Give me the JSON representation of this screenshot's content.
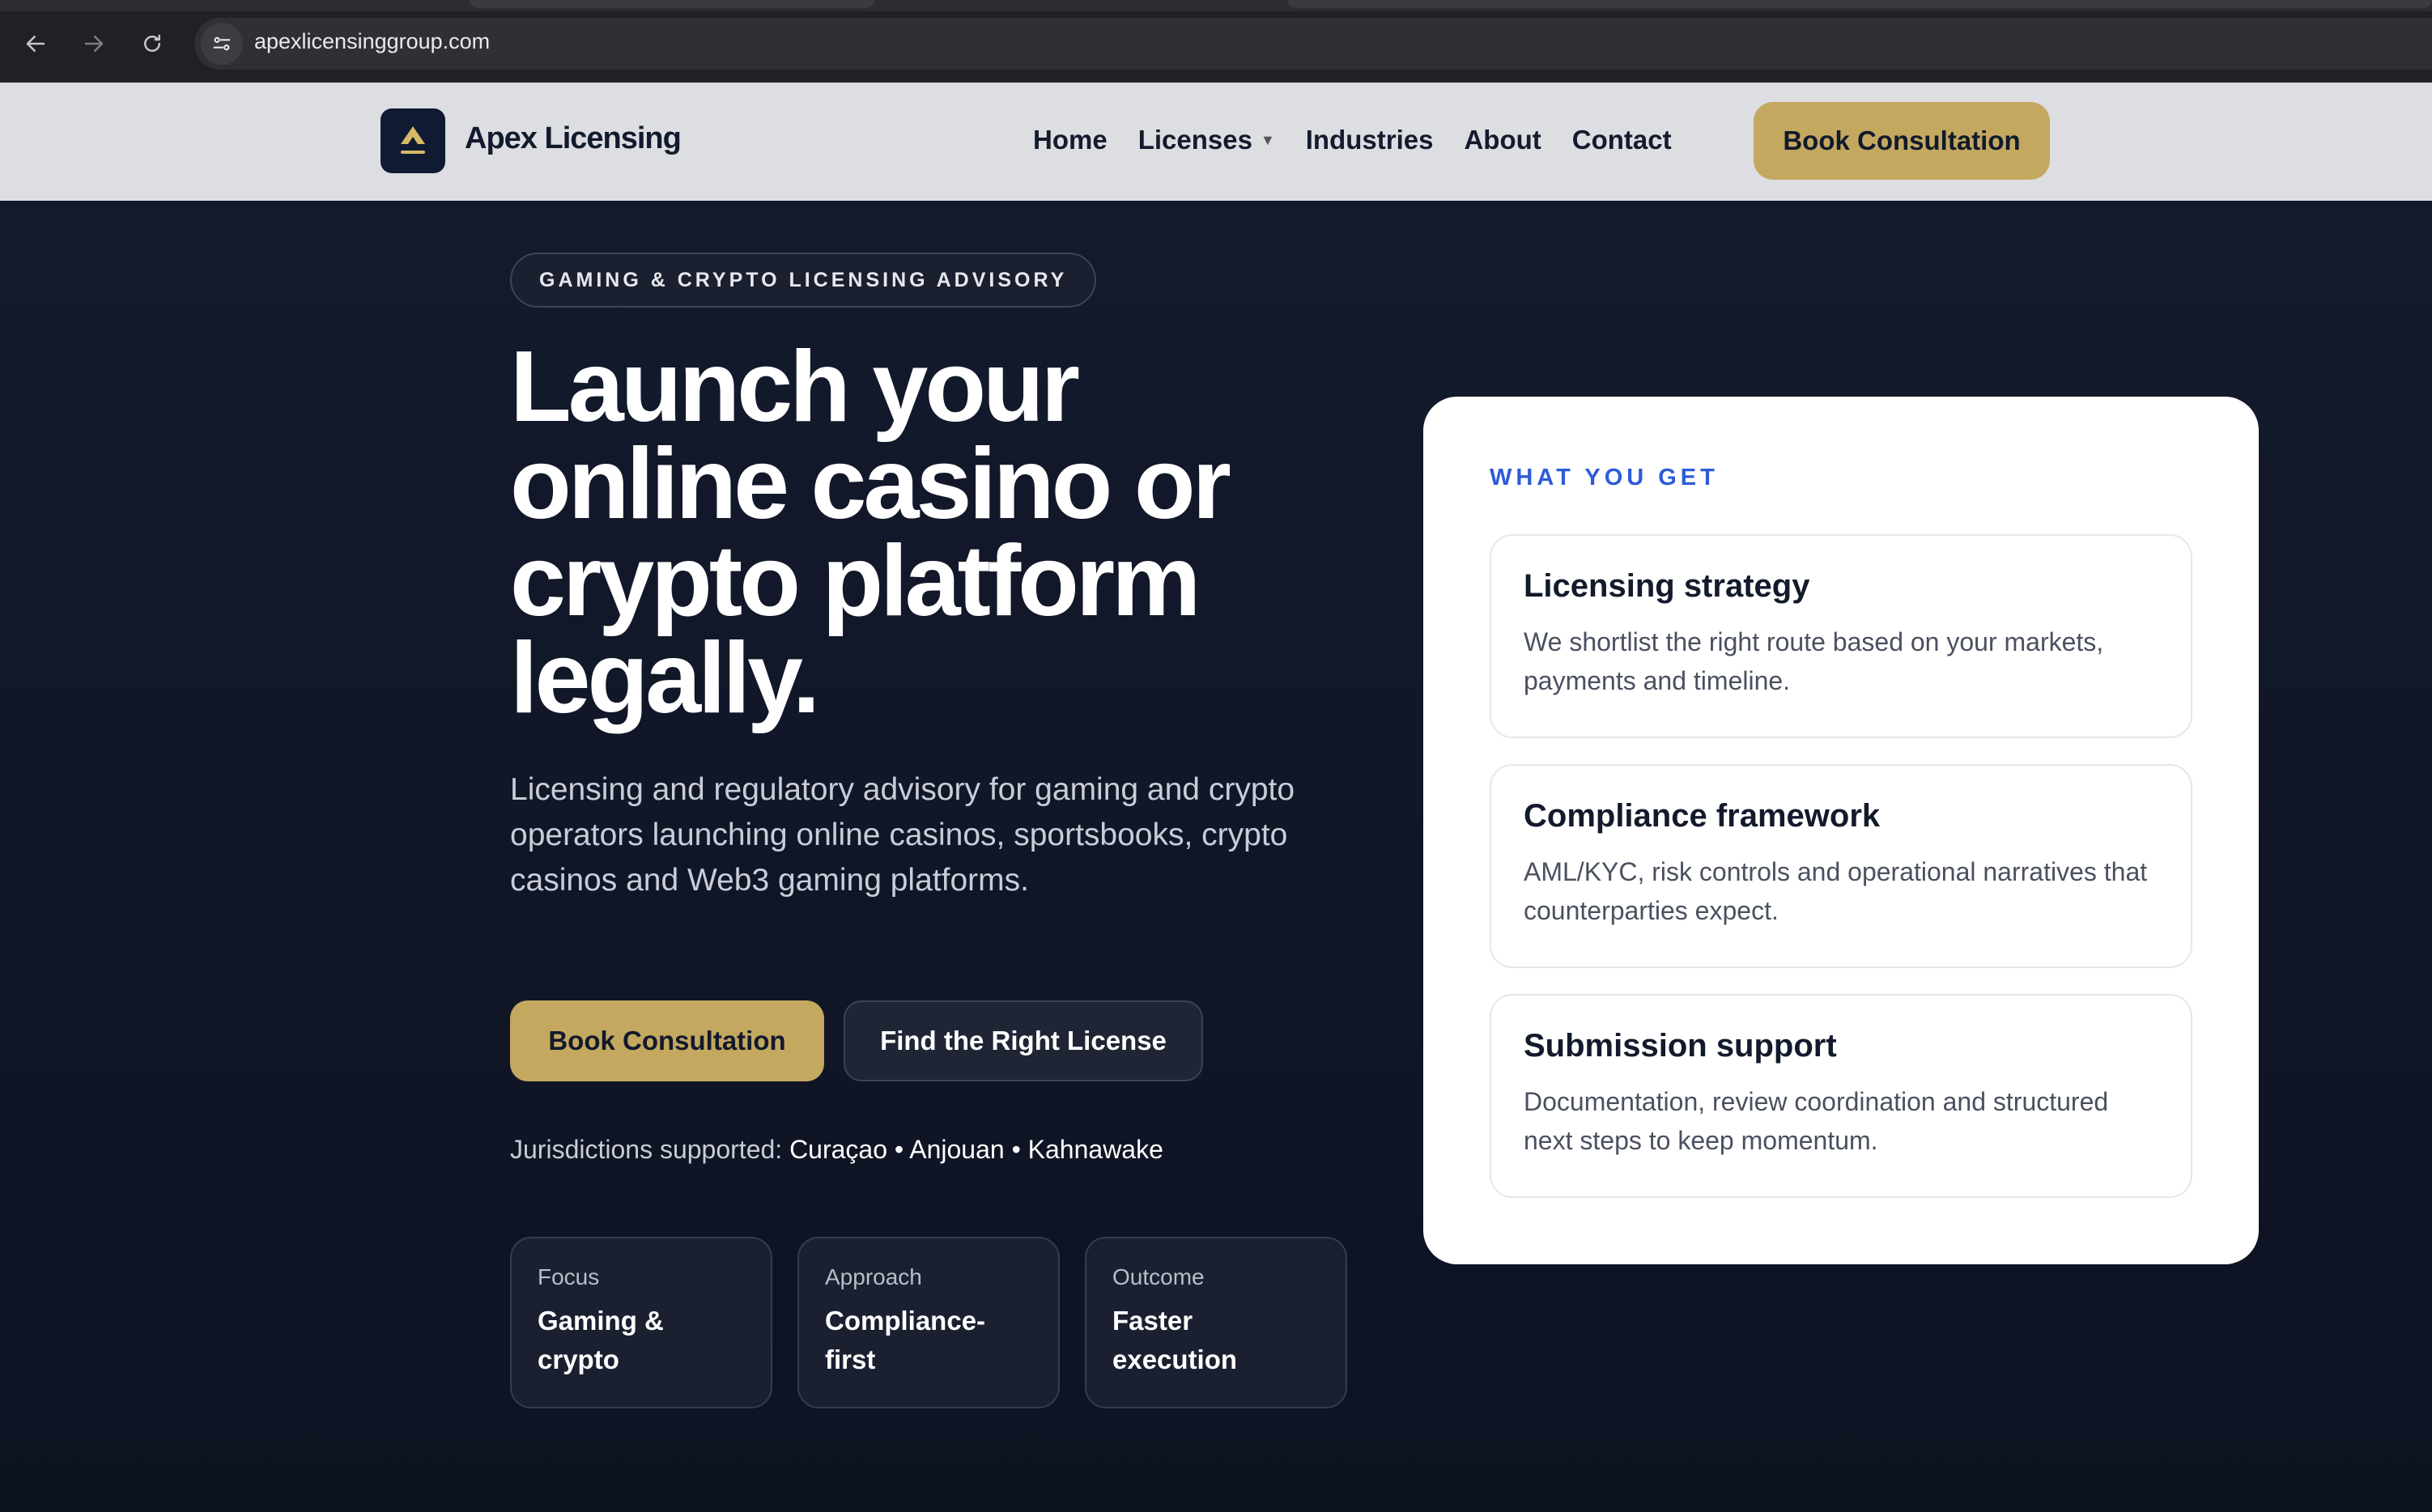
{
  "browser": {
    "url": "apexlicensinggroup.com"
  },
  "header": {
    "brand": "Apex Licensing",
    "nav": [
      "Home",
      "Licenses",
      "Industries",
      "About",
      "Contact"
    ],
    "cta": "Book Consultation"
  },
  "hero": {
    "badge": "GAMING & CRYPTO LICENSING ADVISORY",
    "headline": "Launch your online casino or crypto platform legally.",
    "subtext": "Licensing and regulatory advisory for gaming and crypto operators launching online casinos, sportsbooks, crypto casinos and Web3 gaming platforms.",
    "primary_cta": "Book Consultation",
    "secondary_cta": "Find the Right License",
    "jurisdictions_label": "Jurisdictions supported:",
    "jurisdictions": "Curaçao • Anjouan • Kahnawake",
    "stats": [
      {
        "label": "Focus",
        "value": "Gaming & crypto"
      },
      {
        "label": "Approach",
        "value": "Compliance-first"
      },
      {
        "label": "Outcome",
        "value": "Faster execution"
      }
    ]
  },
  "card": {
    "kicker": "WHAT YOU GET",
    "features": [
      {
        "title": "Licensing strategy",
        "body": "We shortlist the right route based on your markets, payments and timeline."
      },
      {
        "title": "Compliance framework",
        "body": "AML/KYC, risk controls and operational narratives that counterparties expect."
      },
      {
        "title": "Submission support",
        "body": "Documentation, review coordination and structured next steps to keep momentum."
      }
    ]
  },
  "colors": {
    "accent_gold": "#c4a85f",
    "navy": "#111a33",
    "kicker_blue": "#2e5bd8"
  },
  "icons": {
    "back": "back-arrow-icon",
    "forward": "forward-arrow-icon",
    "reload": "reload-icon",
    "site_info": "site-settings-icon",
    "logo": "apex-logo-icon",
    "dropdown": "caret-down-icon"
  }
}
